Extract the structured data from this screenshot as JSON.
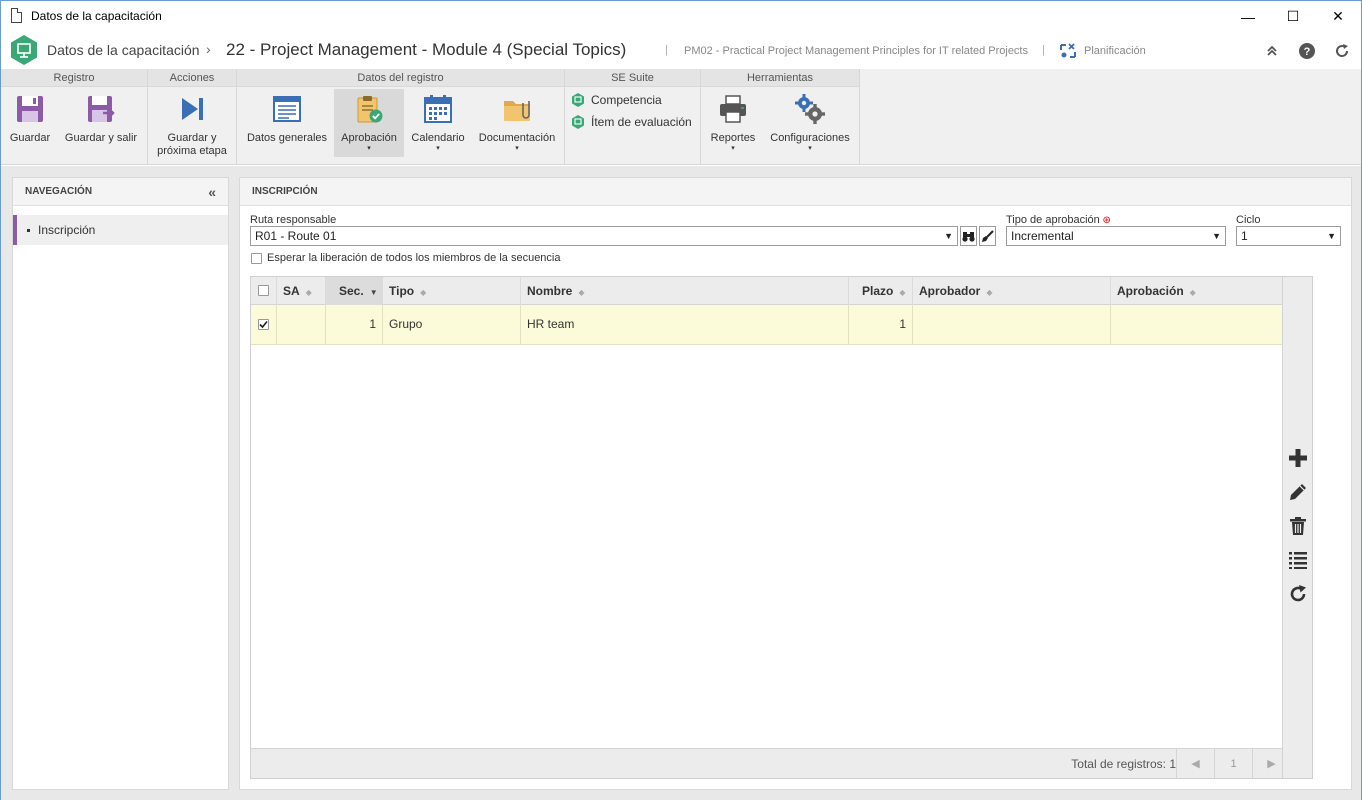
{
  "window": {
    "title": "Datos de la capacitación",
    "minimize": "—",
    "maximize": "☐",
    "close": "✕"
  },
  "header": {
    "breadcrumb": "Datos de la capacitación",
    "separator": "›",
    "title": "22 - Project Management - Module 4 (Special Topics)",
    "divider": "|",
    "subtitle": "PM02 - Practical Project Management Principles for IT related Projects",
    "planning": "Planificación"
  },
  "ribbon": {
    "groups": [
      {
        "title": "Registro"
      },
      {
        "title": "Acciones"
      },
      {
        "title": "Datos del registro"
      },
      {
        "title": "SE Suite"
      },
      {
        "title": "Herramientas"
      }
    ],
    "buttons": {
      "guardar": "Guardar",
      "guardar_salir": "Guardar y salir",
      "guardar_prox_1": "Guardar y",
      "guardar_prox_2": "próxima etapa",
      "datos_generales": "Datos generales",
      "aprobacion": "Aprobación",
      "calendario": "Calendario",
      "documentacion": "Documentación",
      "competencia": "Competencia",
      "item_evaluacion": "Ítem de evaluación",
      "reportes": "Reportes",
      "configuraciones": "Configuraciones"
    },
    "caret": "▾"
  },
  "nav": {
    "title": "NAVEGACIÓN",
    "collapse": "«",
    "items": [
      {
        "label": "Inscripción"
      }
    ]
  },
  "main": {
    "title": "INSCRIPCIÓN",
    "ruta_label": "Ruta responsable",
    "ruta_value": "R01 - Route 01",
    "tipo_label": "Tipo de aprobación",
    "tipo_value": "Incremental",
    "ciclo_label": "Ciclo",
    "ciclo_value": "1",
    "select_arrow": "▼",
    "wait_label": "Esperar la liberación de todos los miembros de la secuencia"
  },
  "grid": {
    "columns": [
      "SA",
      "Sec.",
      "Tipo",
      "Nombre",
      "Plazo",
      "Aprobador",
      "Aprobación"
    ],
    "sort_both": "◆",
    "sort_desc": "▼",
    "rows": [
      {
        "sa": "",
        "sec": "1",
        "tipo": "Grupo",
        "nombre": "HR team",
        "plazo": "1",
        "aprobador": "",
        "aprobacion": ""
      }
    ],
    "total": "Total de registros: 1",
    "page": "1",
    "prev": "◀",
    "next": "▶"
  },
  "colors": {
    "accent_purple": "#8c5aa6",
    "row_highlight": "#fbfbd9",
    "logo_green": "#3aa876"
  }
}
